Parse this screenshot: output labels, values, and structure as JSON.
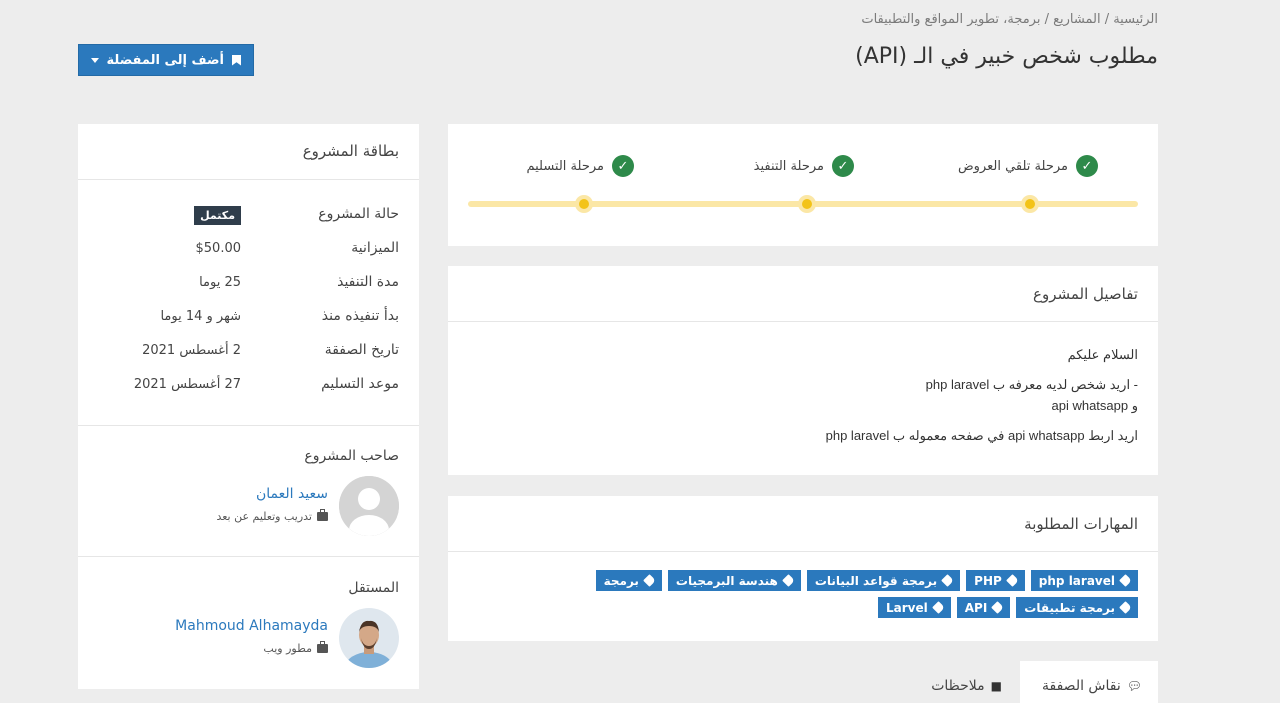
{
  "breadcrumb": "الرئيسية / المشاريع / برمجة، تطوير المواقع والتطبيقات",
  "title": "مطلوب شخص خبير في الـ (API)",
  "favorite_button": "أضف إلى المفضلة",
  "stages": [
    {
      "label": "مرحلة تلقي العروض"
    },
    {
      "label": "مرحلة التنفيذ"
    },
    {
      "label": "مرحلة التسليم"
    }
  ],
  "details": {
    "heading": "تفاصيل المشروع",
    "lines": [
      "السلام عليكم",
      "- اريد شخص لديه معرفه ب php laravel",
      "و api whatsapp",
      "اريد اربط api whatsapp في صفحه معموله ب php laravel"
    ]
  },
  "skills": {
    "heading": "المهارات المطلوبة",
    "tags": [
      "php laravel",
      "PHP",
      "برمجة قواعد البيانات",
      "هندسة البرمجيات",
      "برمجة",
      "برمجة تطبيقات",
      "API",
      "Larvel"
    ]
  },
  "tabs": {
    "discussion": "نقاش الصفقة",
    "notes": "ملاحظات"
  },
  "project_card": {
    "title": "بطاقة المشروع",
    "status_label": "حالة المشروع",
    "status_value": "مكتمل",
    "rows": [
      {
        "label": "الميزانية",
        "value": "$50.00"
      },
      {
        "label": "مدة التنفيذ",
        "value": "25 يوما"
      },
      {
        "label": "بدأ تنفيذه منذ",
        "value": "شهر و 14 يوما"
      },
      {
        "label": "تاريخ الصفقة",
        "value": "2 أغسطس 2021"
      },
      {
        "label": "موعد التسليم",
        "value": "27 أغسطس 2021"
      }
    ]
  },
  "owner": {
    "heading": "صاحب المشروع",
    "name": "سعيد العمان",
    "subtitle": "تدريب وتعليم عن بعد"
  },
  "freelancer": {
    "heading": "المستقل",
    "name": "Mahmoud Alhamayda",
    "subtitle": "مطور ويب"
  },
  "colors": {
    "accent": "#2b79bd",
    "success": "#2e8a4a",
    "progress_track": "#fbe7a6",
    "progress_dot": "#f3c318",
    "badge": "#2f3d4b"
  }
}
